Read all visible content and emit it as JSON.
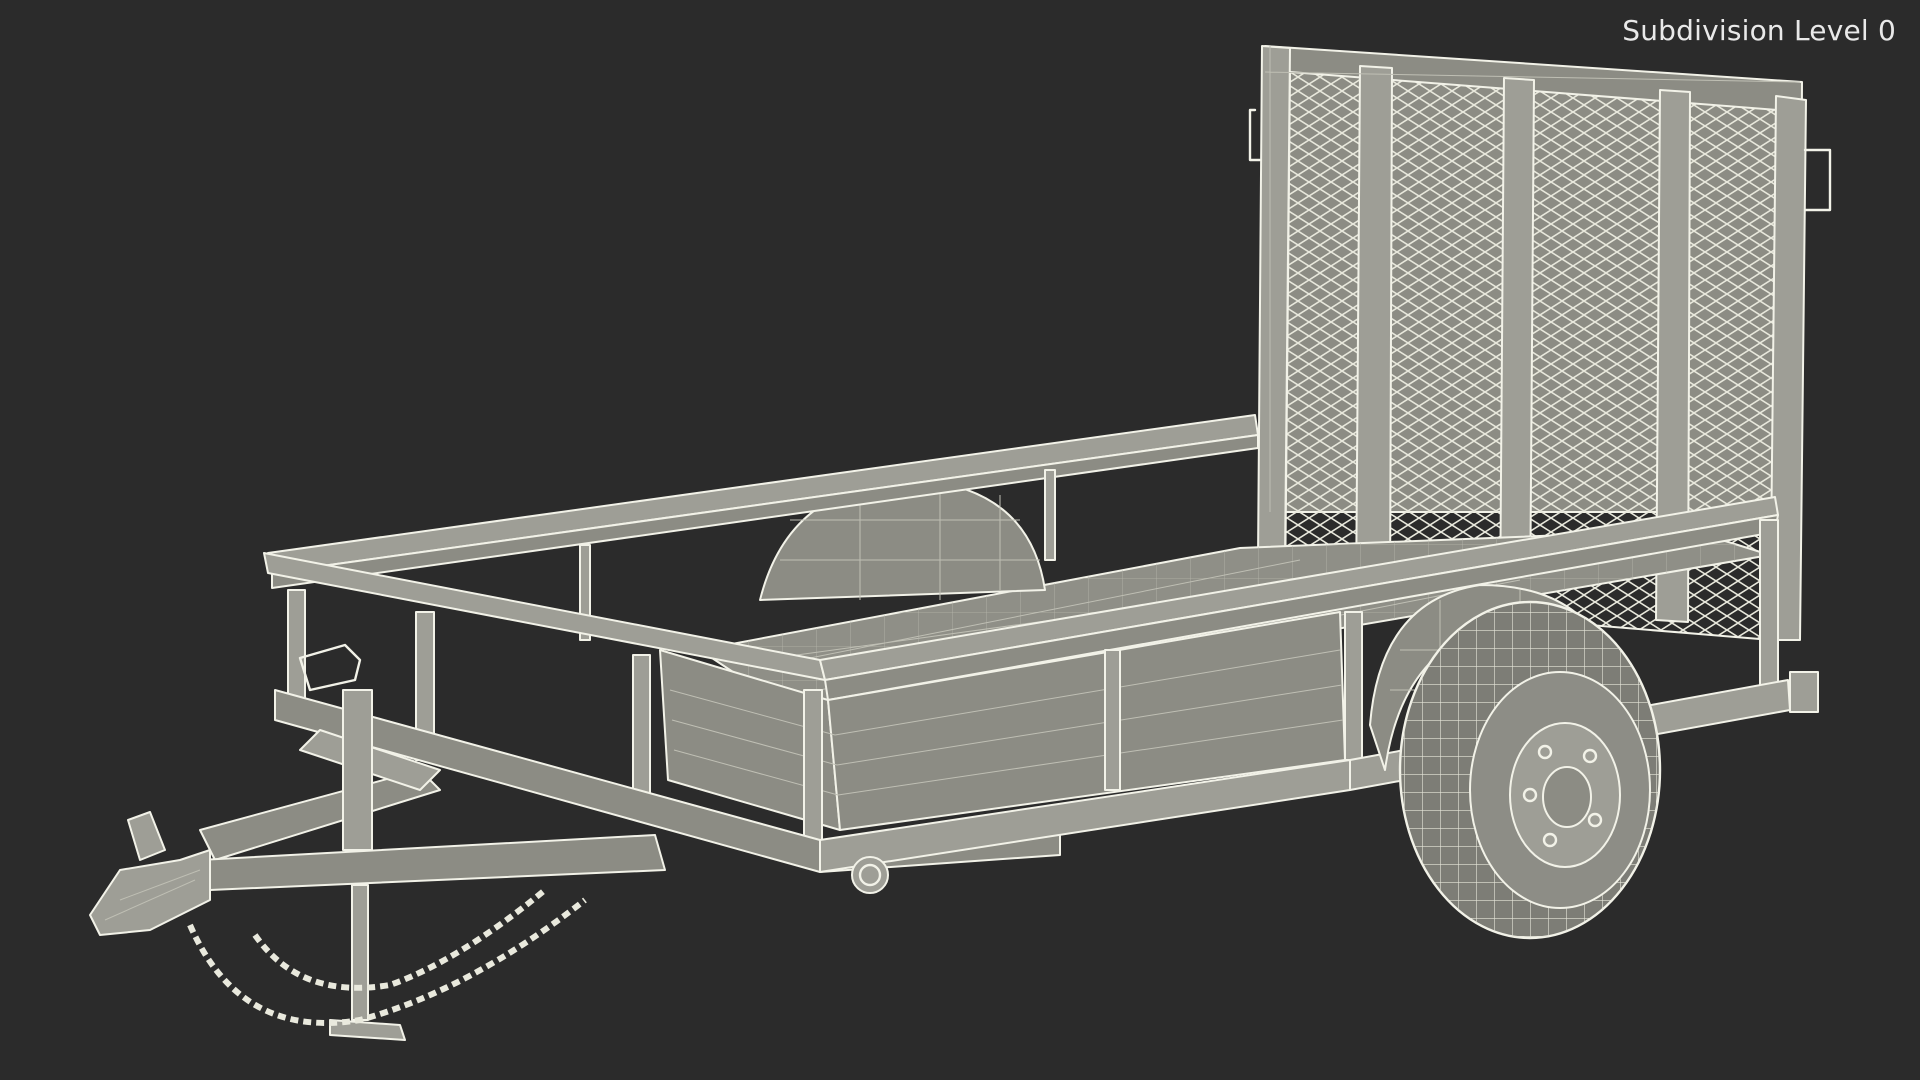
{
  "viewport": {
    "overlay_label": "Subdivision Level 0",
    "background_color": "#2b2b2b",
    "wire_color": "#f2f2e8",
    "model_color": "#8c8c84"
  },
  "model": {
    "parts": [
      "ramp-gate",
      "side-rails",
      "deck",
      "fender",
      "wheel",
      "tongue",
      "coupler",
      "jack",
      "safety-chains"
    ]
  }
}
